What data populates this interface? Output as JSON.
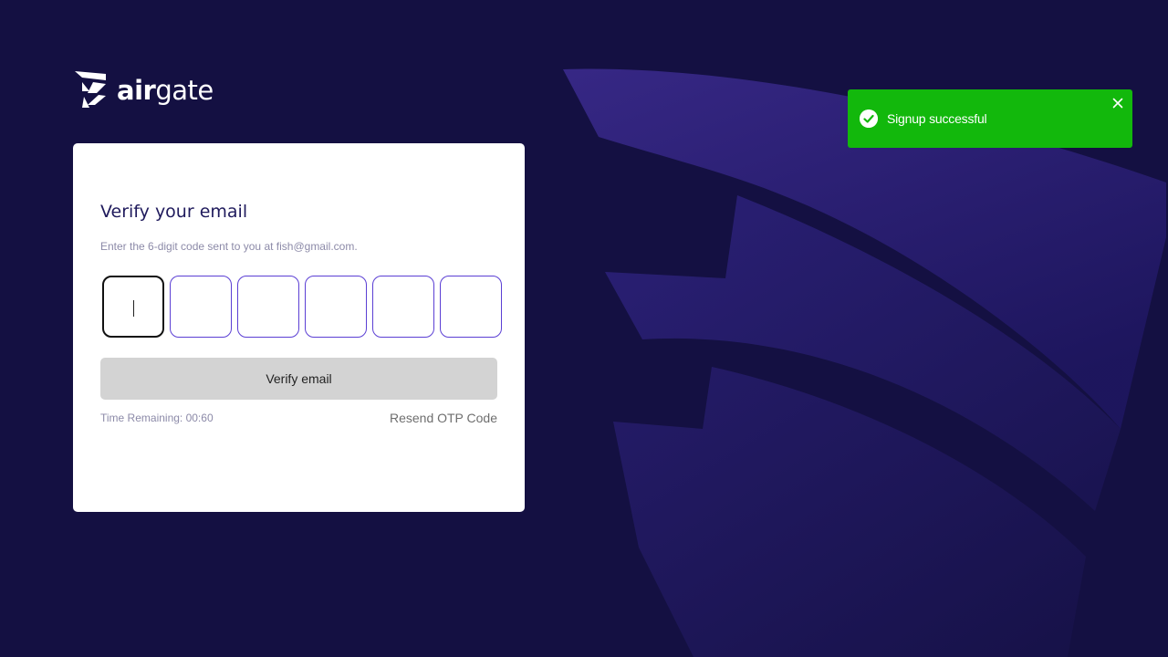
{
  "brand": {
    "name_bold": "air",
    "name_light": "gate",
    "logo_icon": "airgate-logo-icon"
  },
  "colors": {
    "background": "#141042",
    "accent": "#5b3fd4",
    "heading": "#1f1a5c",
    "toast_success": "#12b80c"
  },
  "verify": {
    "title": "Verify your email",
    "subtitle": "Enter the 6-digit code sent to you at fish@gmail.com.",
    "otp_values": [
      "",
      "",
      "",
      "",
      "",
      ""
    ],
    "button_label": "Verify email",
    "timer_text": "Time Remaining: 00:60",
    "resend_label": "Resend OTP Code"
  },
  "toast": {
    "message": "Signup successful",
    "icon": "check-circle-icon",
    "close_icon": "close-icon"
  }
}
